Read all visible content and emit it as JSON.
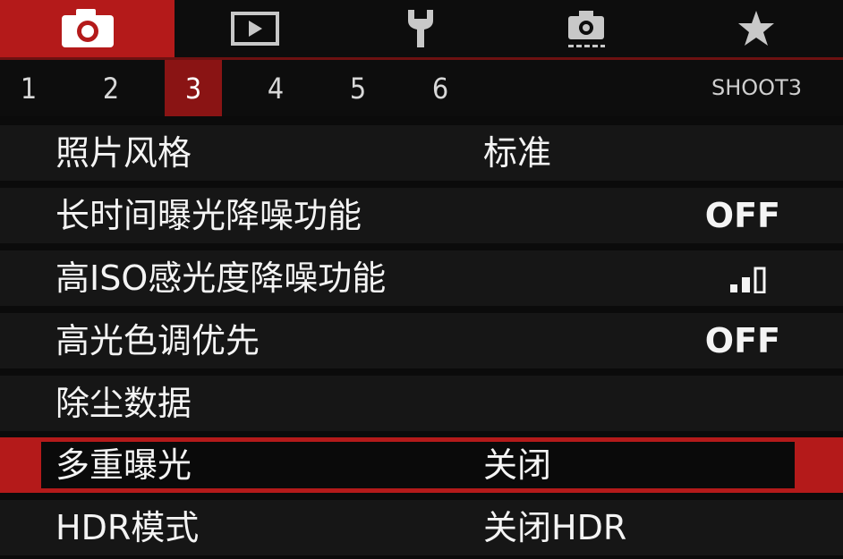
{
  "category_tabs": [
    {
      "icon": "camera-icon",
      "active": true
    },
    {
      "icon": "playback-icon",
      "active": false
    },
    {
      "icon": "wrench-icon",
      "active": false
    },
    {
      "icon": "custom-camera-icon",
      "active": false
    },
    {
      "icon": "star-icon",
      "active": false
    }
  ],
  "page_tabs": {
    "items": [
      "1",
      "2",
      "3",
      "4",
      "5",
      "6"
    ],
    "active_index": 2,
    "page_id": "SHOOT3"
  },
  "menu": {
    "items": [
      {
        "label": "照片风格",
        "value": "标准"
      },
      {
        "label": "长时间曝光降噪功能",
        "value": "OFF"
      },
      {
        "label": "高ISO感光度降噪功能",
        "value": "",
        "value_icon": "noise-reduction-level-icon",
        "level": "standard"
      },
      {
        "label": "高光色调优先",
        "value": "OFF"
      },
      {
        "label": "除尘数据",
        "value": ""
      },
      {
        "label": "多重曝光",
        "value": "关闭",
        "selected": true
      },
      {
        "label": "HDR模式",
        "value": "关闭HDR"
      }
    ]
  },
  "colors": {
    "accent_red": "#b41a1a",
    "dark_red": "#8a1414",
    "background": "#0b0b0b",
    "row_background": "#161616",
    "text": "#f4f4f4"
  }
}
